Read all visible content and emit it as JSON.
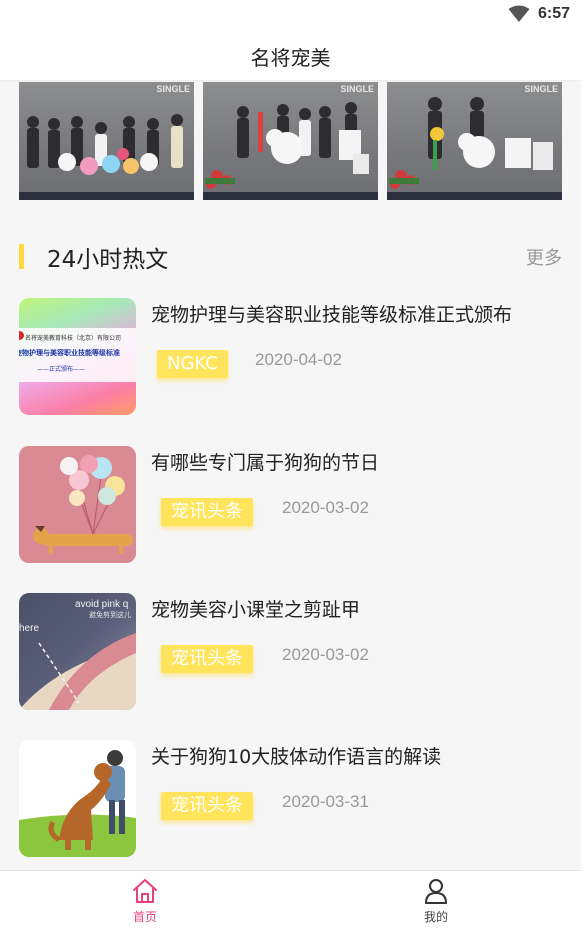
{
  "status_bar": {
    "time": "6:57",
    "wifi_icon": "wifi-icon"
  },
  "app_bar": {
    "title": "名将宠美"
  },
  "gallery": {
    "photos": [
      {
        "sign_text": "SINGLE"
      },
      {
        "sign_text": "SINGLE"
      },
      {
        "sign_text": "SINGLE"
      }
    ]
  },
  "section": {
    "title": "24小时热文",
    "more_label": "更多",
    "accent_color": "#ffd93b"
  },
  "articles": [
    {
      "title": "宠物护理与美容职业技能等级标准正式颁布",
      "tag": "NGKC",
      "date": "2020-04-02",
      "thumb": {
        "line1": "名将宠美教育科技（北京）有限公司",
        "line2": "宠物护理与美容职业技能等级标准",
        "line3": "——正式颁布——"
      }
    },
    {
      "title": "有哪些专门属于狗狗的节日",
      "tag": "宠讯头条",
      "date": "2020-03-02"
    },
    {
      "title": "宠物美容小课堂之剪趾甲",
      "tag": "宠讯头条",
      "date": "2020-03-02",
      "thumb": {
        "line1": "avoid pink q",
        "line2": "避免剪到这儿",
        "line3": "here"
      }
    },
    {
      "title": "关于狗狗10大肢体动作语言的解读",
      "tag": "宠讯头条",
      "date": "2020-03-31"
    }
  ],
  "bottom_nav": {
    "items": [
      {
        "label": "首页",
        "icon": "home-icon",
        "active": true
      },
      {
        "label": "我的",
        "icon": "user-icon",
        "active": false
      }
    ],
    "active_color": "#e8407c"
  },
  "colors": {
    "tag_background": "#ffe45c",
    "background": "#f6f6f6"
  }
}
